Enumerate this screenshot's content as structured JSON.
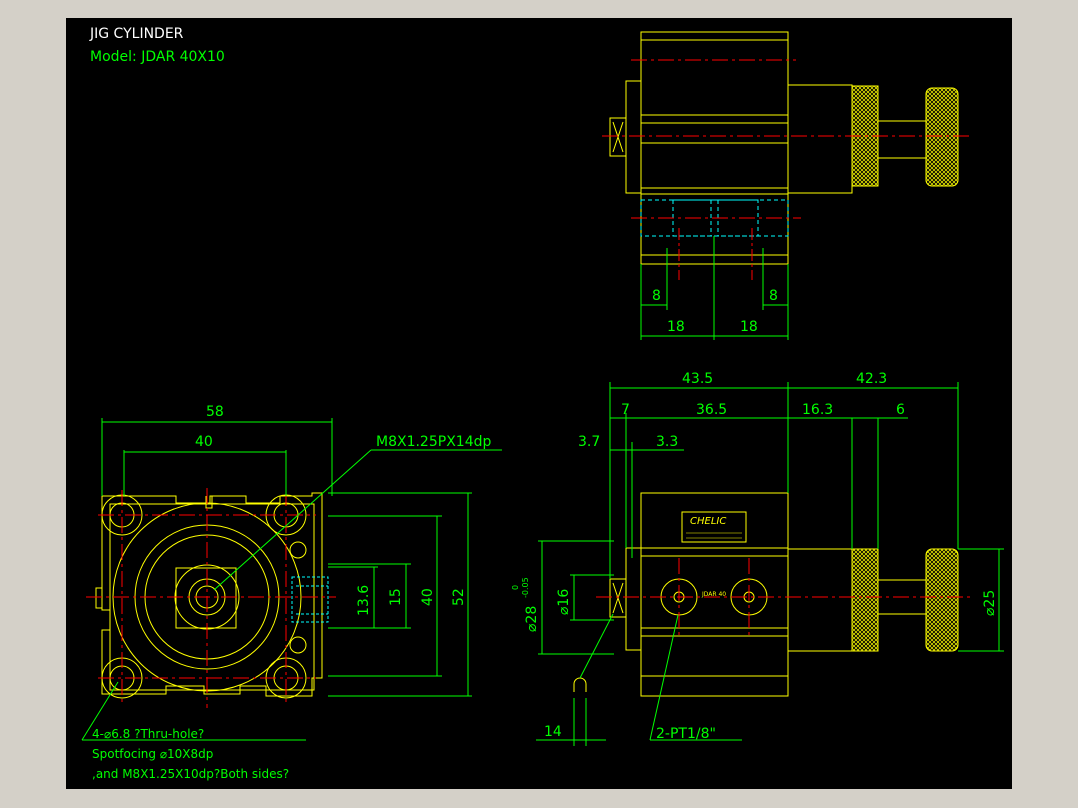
{
  "title_block": {
    "title": "JIG CYLINDER",
    "model": "Model:  JDAR  40X10"
  },
  "dimensions": {
    "top_view": {
      "left_8": "8",
      "right_8": "8",
      "left_18": "18",
      "right_18": "18"
    },
    "front_view": {
      "width_58": "58",
      "width_40": "40",
      "callout_thread": "M8X1.25PX14dp",
      "height_13_6": "13.6",
      "height_15": "15",
      "height_40": "40",
      "height_52": "52"
    },
    "side_view": {
      "len_43_5": "43.5",
      "len_42_3": "42.3",
      "len_7": "7",
      "len_36_5": "36.5",
      "len_16_3": "16.3",
      "len_6": "6",
      "len_3_7": "3.7",
      "len_3_3": "3.3",
      "dia_28": "⌀28",
      "dia_28_tol_upper": "0",
      "dia_28_tol_lower": "-0.05",
      "dia_16": "⌀16",
      "dia_25": "⌀25",
      "len_14": "14",
      "port_callout": "2-PT1/8\""
    }
  },
  "notes": {
    "line1": "4-⌀6.8  ?Thru-hole?",
    "line2": "Spotfocing  ⌀10X8dp",
    "line3": ",and M8X1.25X10dp?Both  sides?"
  },
  "nameplate": {
    "brand": "CHELIC",
    "model_small": "JDAR  40"
  },
  "colors": {
    "background": "#000000",
    "frame": "#d4d0c8",
    "outline": "#ffff00",
    "dimension": "#00ff00",
    "centerline": "#ff0000",
    "hidden": "#00ffff",
    "text_white": "#ffffff"
  }
}
